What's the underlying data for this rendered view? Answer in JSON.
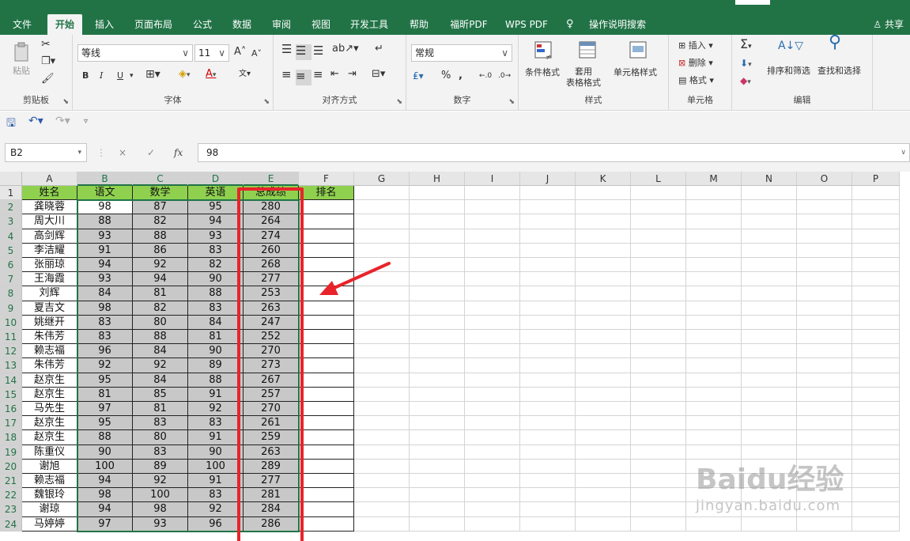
{
  "tabs": [
    {
      "label": "文件",
      "active": false
    },
    {
      "label": "开始",
      "active": true
    },
    {
      "label": "插入",
      "active": false
    },
    {
      "label": "页面布局",
      "active": false
    },
    {
      "label": "公式",
      "active": false
    },
    {
      "label": "数据",
      "active": false
    },
    {
      "label": "审阅",
      "active": false
    },
    {
      "label": "视图",
      "active": false
    },
    {
      "label": "开发工具",
      "active": false
    },
    {
      "label": "帮助",
      "active": false
    },
    {
      "label": "福昕PDF",
      "active": false
    },
    {
      "label": "WPS PDF",
      "active": false
    },
    {
      "label": "操作说明搜索",
      "active": false
    }
  ],
  "share_label": "共享",
  "ribbon": {
    "clipboard": {
      "label": "剪贴板",
      "paste": "粘贴"
    },
    "font": {
      "label": "字体",
      "name": "等线",
      "size": "11",
      "bold": "B",
      "italic": "I",
      "underline": "U",
      "grow": "A",
      "shrink": "A"
    },
    "alignment": {
      "label": "对齐方式"
    },
    "number": {
      "label": "数字",
      "format": "常规",
      "percent": "%",
      "comma": ","
    },
    "styles": {
      "label": "样式",
      "conditional": "条件格式",
      "table_fmt": "套用\n表格格式",
      "cell_style": "单元格样式"
    },
    "cells": {
      "label": "单元格",
      "insert": "插入",
      "delete": "删除",
      "format": "格式"
    },
    "editing": {
      "label": "编辑",
      "sort_filter": "排序和筛选",
      "find_select": "查找和选择"
    }
  },
  "formula_bar": {
    "name_box": "B2",
    "value": "98",
    "fx": "fx",
    "cancel": "×",
    "enter": "✓"
  },
  "columns": [
    "A",
    "B",
    "C",
    "D",
    "E",
    "F",
    "G",
    "H",
    "I",
    "J",
    "K",
    "L",
    "M",
    "N",
    "O",
    "P"
  ],
  "header_row": [
    "姓名",
    "语文",
    "数学",
    "英语",
    "总成绩",
    "排名"
  ],
  "rows": [
    [
      "龚晓蓉",
      "98",
      "87",
      "95",
      "280"
    ],
    [
      "周大川",
      "88",
      "82",
      "94",
      "264"
    ],
    [
      "高剑辉",
      "93",
      "88",
      "93",
      "274"
    ],
    [
      "李洁耀",
      "91",
      "86",
      "83",
      "260"
    ],
    [
      "张丽琼",
      "94",
      "92",
      "82",
      "268"
    ],
    [
      "王海霞",
      "93",
      "94",
      "90",
      "277"
    ],
    [
      "刘辉",
      "84",
      "81",
      "88",
      "253"
    ],
    [
      "夏吉文",
      "98",
      "82",
      "83",
      "263"
    ],
    [
      "姚继开",
      "83",
      "80",
      "84",
      "247"
    ],
    [
      "朱伟芳",
      "83",
      "88",
      "81",
      "252"
    ],
    [
      "赖志福",
      "96",
      "84",
      "90",
      "270"
    ],
    [
      "朱伟芳",
      "92",
      "92",
      "89",
      "273"
    ],
    [
      "赵京生",
      "95",
      "84",
      "88",
      "267"
    ],
    [
      "赵京生",
      "81",
      "85",
      "91",
      "257"
    ],
    [
      "马先生",
      "97",
      "81",
      "92",
      "270"
    ],
    [
      "赵京生",
      "95",
      "83",
      "83",
      "261"
    ],
    [
      "赵京生",
      "88",
      "80",
      "91",
      "259"
    ],
    [
      "陈重仪",
      "90",
      "83",
      "90",
      "263"
    ],
    [
      "谢旭",
      "100",
      "89",
      "100",
      "289"
    ],
    [
      "赖志福",
      "94",
      "92",
      "91",
      "277"
    ],
    [
      "魏银玲",
      "98",
      "100",
      "83",
      "281"
    ],
    [
      "谢琼",
      "94",
      "98",
      "92",
      "284"
    ],
    [
      "马婷婷",
      "97",
      "93",
      "96",
      "286"
    ]
  ],
  "watermark": {
    "brand": "Baidu经验",
    "url": "jingyan.baidu.com"
  },
  "colors": {
    "excel_green": "#217346",
    "header_fill": "#8fd14f",
    "selection_fill": "#c8c8c8",
    "annotation_red": "#e8242b"
  }
}
